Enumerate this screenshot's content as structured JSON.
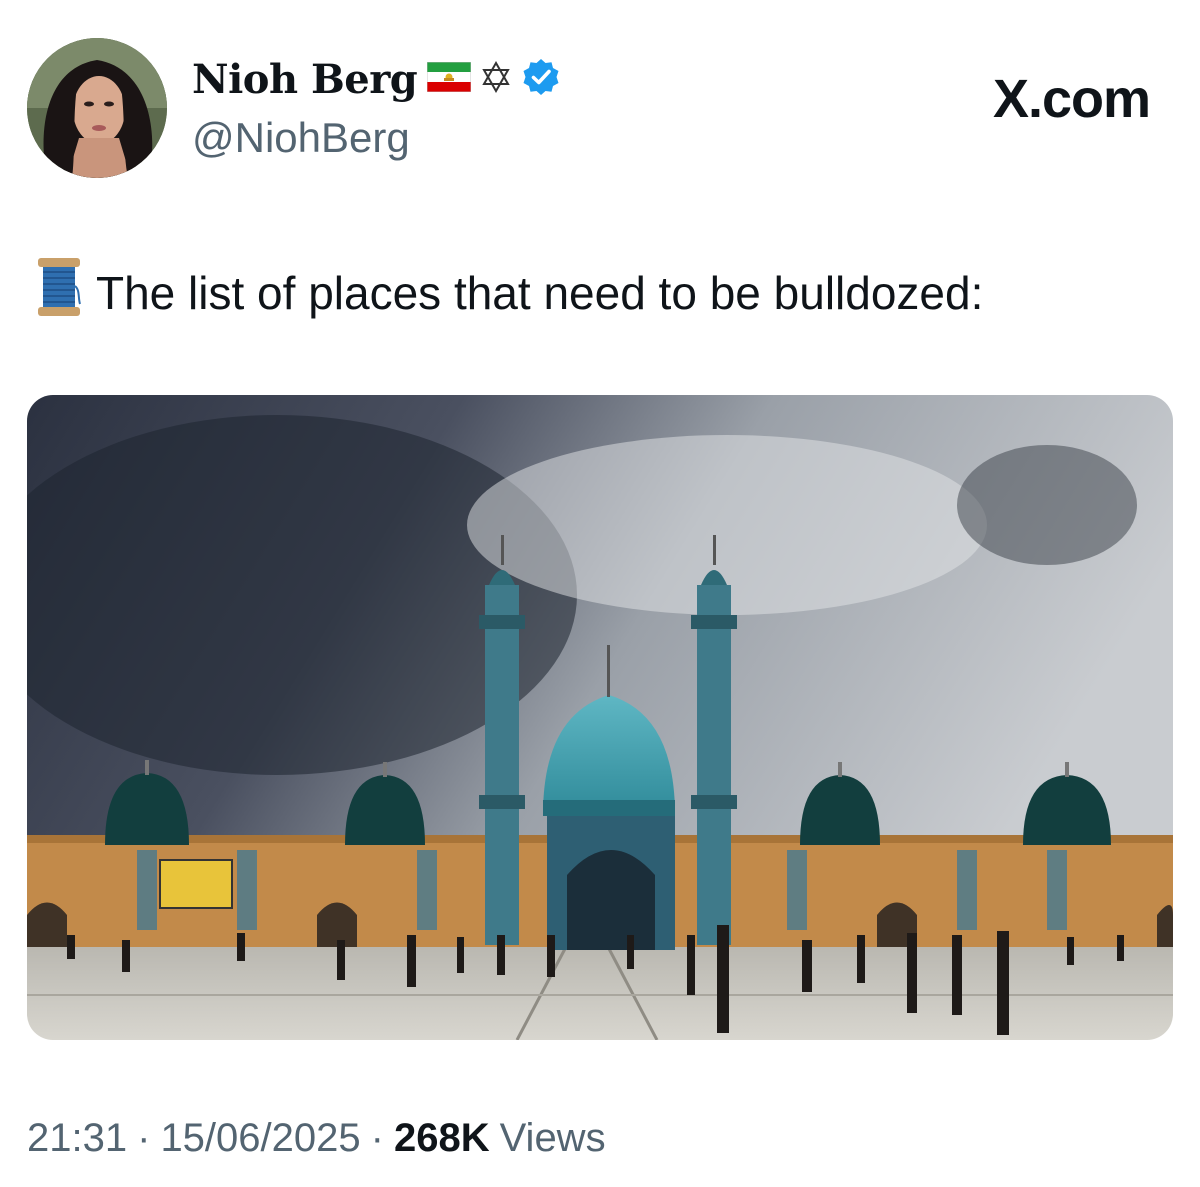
{
  "author": {
    "display_name": "Nioh Berg",
    "handle": "@NiohBerg",
    "badges": [
      "iran-lion-sun-flag-icon",
      "star-of-david-icon",
      "verified-badge-icon"
    ],
    "verified_color": "#1d9bf0"
  },
  "site_label": "X.com",
  "tweet": {
    "emoji": "spool-of-thread-icon",
    "text": "The list of places that need to be bulldozed:"
  },
  "media": {
    "description_icon": "mosque-photo"
  },
  "footer": {
    "time": "21:31",
    "separator": "·",
    "date": "15/06/2025",
    "views_count": "268K",
    "views_label": "Views"
  },
  "colors": {
    "text_primary": "#0f1419",
    "text_secondary": "#536471",
    "accent": "#1d9bf0"
  }
}
